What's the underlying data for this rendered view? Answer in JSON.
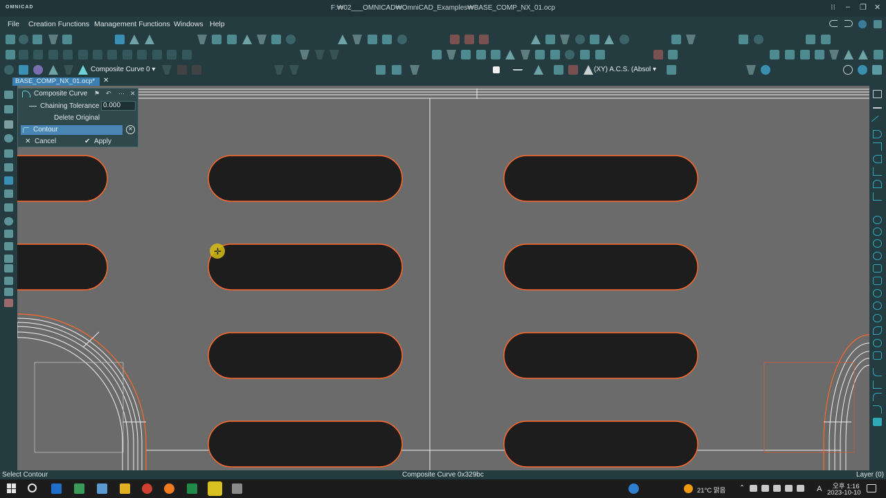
{
  "window": {
    "logo": "OMNICAD",
    "title": "F:₩02___OMNICAD₩OmniCAD_Examples₩BASE_COMP_NX_01.ocp",
    "pin": "⁝⁝",
    "minimize": "–",
    "maximize": "❐",
    "close": "✕"
  },
  "menu": {
    "items": [
      "File",
      "Creation Functions",
      "Management Functions",
      "Windows",
      "Help"
    ]
  },
  "toolbar": {
    "curve_type_combo": "Composite Curve 0 ▾",
    "coord_system_combo": "(XY) A.C.S. (Absol ▾"
  },
  "file_tab": {
    "label": "BASE_COMP_NX_01.ocp*",
    "close": "✕"
  },
  "panel": {
    "title": "Composite Curve",
    "close": "✕",
    "chaining_tolerance_label": "Chaining Tolerance",
    "chaining_tolerance_value": "0.000",
    "delete_original_label": "Delete Original",
    "contour_label": "Contour",
    "cancel_label": "Cancel",
    "apply_label": "Apply"
  },
  "status": {
    "prompt": "Select Contour",
    "selection": "Composite Curve 0x329bc",
    "layer": "Layer (0)"
  },
  "taskbar": {
    "weather": "21°C 맑음",
    "ime": "A",
    "time": "오후 1:16",
    "date": "2023-10-10"
  },
  "colors": {
    "viewport_bg": "#6b6b6b",
    "slot_fill": "#1d1d1d",
    "slot_outline": "#ff6a2a",
    "app_bg": "#243c40",
    "selection_blue": "#4a86b5"
  }
}
